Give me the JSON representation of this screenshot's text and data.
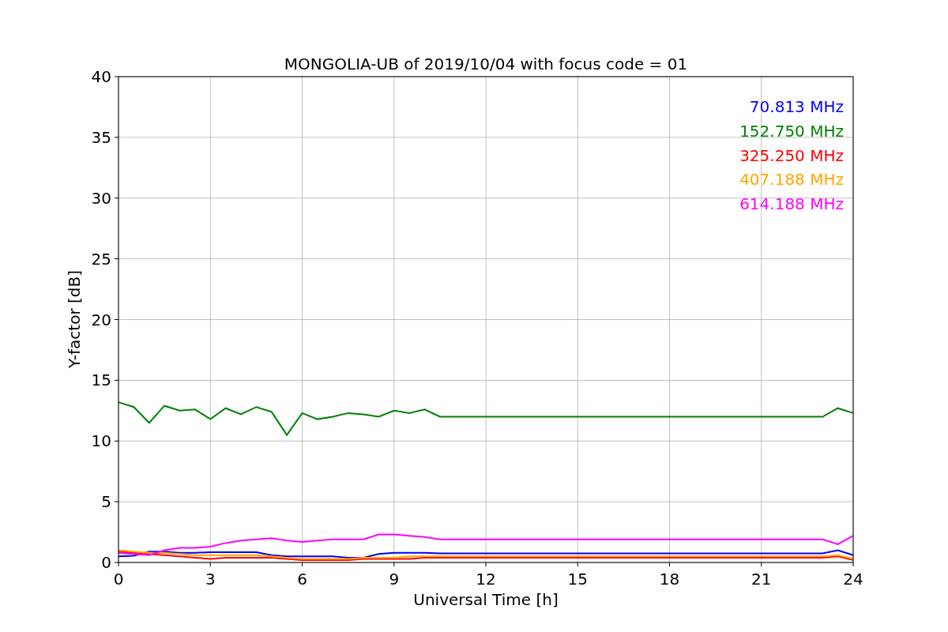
{
  "figure": {
    "chart_data": {
      "type": "line",
      "title": "MONGOLIA-UB of 2019/10/04 with focus code = 01",
      "xlabel": "Universal Time [h]",
      "ylabel": "Y-factor [dB]",
      "x": [
        0,
        0.5,
        1,
        1.5,
        2,
        2.5,
        3,
        3.5,
        4,
        4.5,
        5,
        5.5,
        6,
        6.5,
        7,
        7.5,
        8,
        8.5,
        9,
        9.5,
        10,
        10.5,
        11,
        11.5,
        12,
        12.5,
        13,
        13.5,
        14,
        14.5,
        15,
        15.5,
        16,
        16.5,
        17,
        17.5,
        18,
        18.5,
        19,
        19.5,
        20,
        20.5,
        21,
        21.5,
        22,
        22.5,
        23,
        23.5,
        24
      ],
      "series": [
        {
          "name": "70.813 MHz",
          "color": "#0000ff",
          "values": [
            0.5,
            0.55,
            0.9,
            0.9,
            0.8,
            0.8,
            0.85,
            0.85,
            0.85,
            0.85,
            0.6,
            0.5,
            0.5,
            0.5,
            0.5,
            0.4,
            0.4,
            0.7,
            0.8,
            0.8,
            0.8,
            0.75,
            0.75,
            0.75,
            0.75,
            0.75,
            0.75,
            0.75,
            0.75,
            0.75,
            0.75,
            0.75,
            0.75,
            0.75,
            0.75,
            0.75,
            0.75,
            0.75,
            0.75,
            0.75,
            0.75,
            0.75,
            0.75,
            0.75,
            0.75,
            0.75,
            0.75,
            1.0,
            0.6
          ]
        },
        {
          "name": "152.750 MHz",
          "color": "#008000",
          "values": [
            13.2,
            12.8,
            11.5,
            12.9,
            12.5,
            12.6,
            11.8,
            12.7,
            12.2,
            12.8,
            12.4,
            10.5,
            12.3,
            11.8,
            12.0,
            12.3,
            12.2,
            12.0,
            12.5,
            12.3,
            12.6,
            12.0,
            12.0,
            12.0,
            12.0,
            12.0,
            12.0,
            12.0,
            12.0,
            12.0,
            12.0,
            12.0,
            12.0,
            12.0,
            12.0,
            12.0,
            12.0,
            12.0,
            12.0,
            12.0,
            12.0,
            12.0,
            12.0,
            12.0,
            12.0,
            12.0,
            12.0,
            12.7,
            12.3
          ]
        },
        {
          "name": "325.250 MHz",
          "color": "#ff0000",
          "values": [
            0.9,
            0.8,
            0.7,
            0.6,
            0.5,
            0.4,
            0.3,
            0.4,
            0.4,
            0.4,
            0.4,
            0.3,
            0.2,
            0.2,
            0.2,
            0.2,
            0.3,
            0.3,
            0.3,
            0.3,
            0.4,
            0.4,
            0.4,
            0.4,
            0.4,
            0.4,
            0.4,
            0.4,
            0.4,
            0.4,
            0.4,
            0.4,
            0.4,
            0.4,
            0.4,
            0.4,
            0.4,
            0.4,
            0.4,
            0.4,
            0.4,
            0.4,
            0.4,
            0.4,
            0.4,
            0.4,
            0.4,
            0.5,
            0.2
          ]
        },
        {
          "name": "407.188 MHz",
          "color": "#ffa500",
          "values": [
            1.0,
            0.9,
            0.8,
            0.8,
            0.7,
            0.6,
            0.6,
            0.6,
            0.6,
            0.6,
            0.5,
            0.4,
            0.3,
            0.3,
            0.3,
            0.3,
            0.4,
            0.4,
            0.4,
            0.5,
            0.5,
            0.5,
            0.5,
            0.5,
            0.5,
            0.5,
            0.5,
            0.5,
            0.5,
            0.5,
            0.5,
            0.5,
            0.5,
            0.5,
            0.5,
            0.5,
            0.5,
            0.5,
            0.5,
            0.5,
            0.5,
            0.5,
            0.5,
            0.5,
            0.5,
            0.5,
            0.5,
            0.6,
            0.3
          ]
        },
        {
          "name": "614.188 MHz",
          "color": "#ff00ff",
          "values": [
            0.8,
            0.7,
            0.6,
            1.0,
            1.2,
            1.2,
            1.3,
            1.6,
            1.8,
            1.9,
            2.0,
            1.8,
            1.7,
            1.8,
            1.9,
            1.9,
            1.9,
            2.3,
            2.3,
            2.2,
            2.1,
            1.9,
            1.9,
            1.9,
            1.9,
            1.9,
            1.9,
            1.9,
            1.9,
            1.9,
            1.9,
            1.9,
            1.9,
            1.9,
            1.9,
            1.9,
            1.9,
            1.9,
            1.9,
            1.9,
            1.9,
            1.9,
            1.9,
            1.9,
            1.9,
            1.9,
            1.9,
            1.5,
            2.2
          ]
        }
      ],
      "grid": true,
      "xlim": [
        0,
        24
      ],
      "ylim": [
        0,
        40
      ],
      "xticks": [
        0,
        3,
        6,
        9,
        12,
        15,
        18,
        21,
        24
      ],
      "yticks": [
        0,
        5,
        10,
        15,
        20,
        25,
        30,
        35,
        40
      ]
    }
  }
}
